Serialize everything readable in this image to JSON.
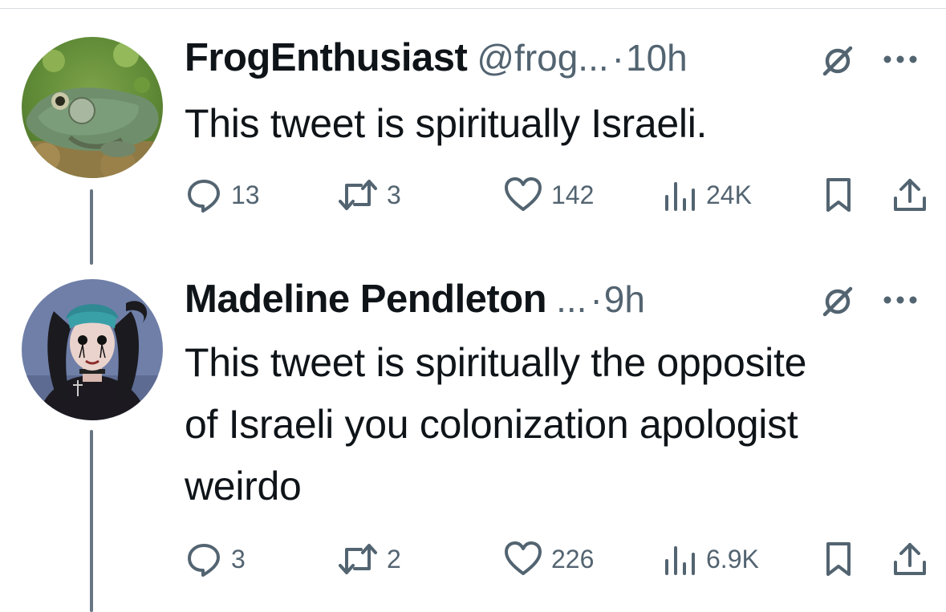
{
  "tweets": [
    {
      "display_name": "FrogEnthusiast",
      "handle": "@frog...",
      "separator": "·",
      "time": "10h",
      "text": "This tweet is spiritually Israeli.",
      "replies": "13",
      "retweets": "3",
      "likes": "142",
      "views": "24K"
    },
    {
      "display_name": "Madeline Pendleton",
      "handle": "...",
      "separator": "·",
      "time": "9h",
      "text": "This tweet is spiritually the opposite of Israeli you colonization apologist weirdo",
      "replies": "3",
      "retweets": "2",
      "likes": "226",
      "views": "6.9K"
    }
  ],
  "colors": {
    "text": "#0f1419",
    "secondary": "#536471",
    "thread_line": "#687684"
  }
}
